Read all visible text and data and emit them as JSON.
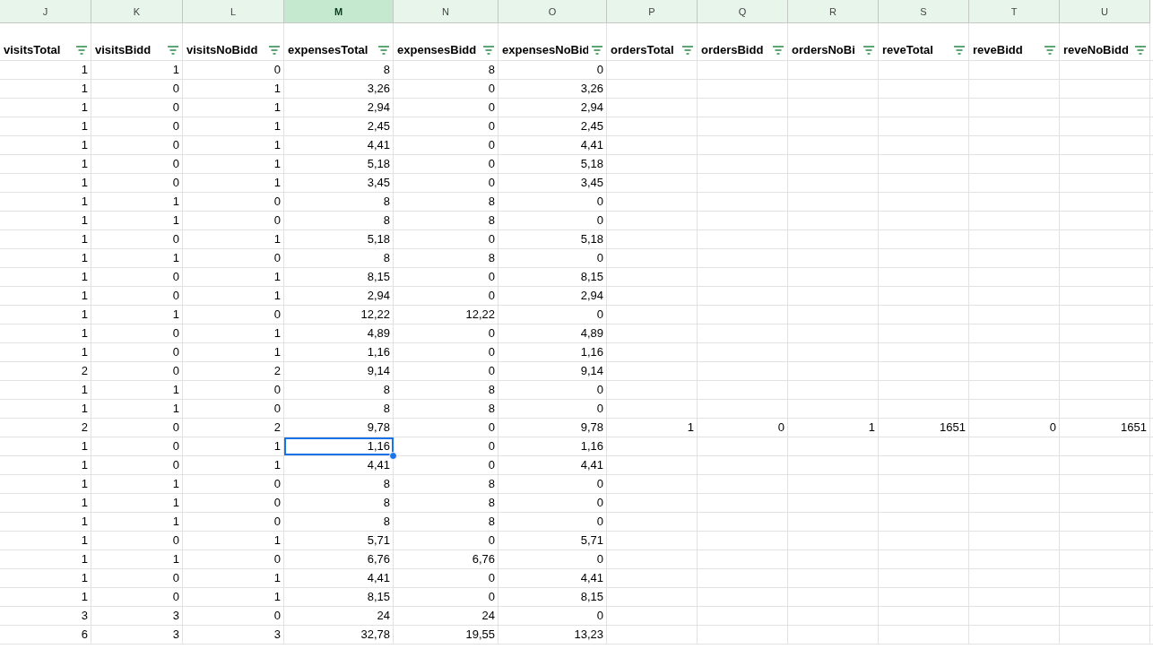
{
  "columns": [
    {
      "letter": "J",
      "header": "visitsTotal",
      "selected": false
    },
    {
      "letter": "K",
      "header": "visitsBidd",
      "selected": false
    },
    {
      "letter": "L",
      "header": "visitsNoBidd",
      "selected": false
    },
    {
      "letter": "M",
      "header": "expensesTotal",
      "selected": true
    },
    {
      "letter": "N",
      "header": "expensesBidd",
      "selected": false
    },
    {
      "letter": "O",
      "header": "expensesNoBid",
      "selected": false
    },
    {
      "letter": "P",
      "header": "ordersTotal",
      "selected": false
    },
    {
      "letter": "Q",
      "header": "ordersBidd",
      "selected": false
    },
    {
      "letter": "R",
      "header": "ordersNoBi",
      "selected": false
    },
    {
      "letter": "S",
      "header": "reveTotal",
      "selected": false
    },
    {
      "letter": "T",
      "header": "reveBidd",
      "selected": false
    },
    {
      "letter": "U",
      "header": "reveNoBidd",
      "selected": false
    }
  ],
  "rows": [
    {
      "selected": false,
      "cells": [
        "1",
        "1",
        "0",
        "8",
        "8",
        "0"
      ]
    },
    {
      "selected": false,
      "cells": [
        "1",
        "0",
        "1",
        "3,26",
        "0",
        "3,26"
      ]
    },
    {
      "selected": false,
      "cells": [
        "1",
        "0",
        "1",
        "2,94",
        "0",
        "2,94"
      ]
    },
    {
      "selected": false,
      "cells": [
        "1",
        "0",
        "1",
        "2,45",
        "0",
        "2,45"
      ]
    },
    {
      "selected": false,
      "cells": [
        "1",
        "0",
        "1",
        "4,41",
        "0",
        "4,41"
      ]
    },
    {
      "selected": false,
      "cells": [
        "1",
        "0",
        "1",
        "5,18",
        "0",
        "5,18"
      ]
    },
    {
      "selected": false,
      "cells": [
        "1",
        "0",
        "1",
        "3,45",
        "0",
        "3,45"
      ]
    },
    {
      "selected": false,
      "cells": [
        "1",
        "1",
        "0",
        "8",
        "8",
        "0"
      ]
    },
    {
      "selected": false,
      "cells": [
        "1",
        "1",
        "0",
        "8",
        "8",
        "0"
      ]
    },
    {
      "selected": false,
      "cells": [
        "1",
        "0",
        "1",
        "5,18",
        "0",
        "5,18"
      ]
    },
    {
      "selected": false,
      "cells": [
        "1",
        "1",
        "0",
        "8",
        "8",
        "0"
      ]
    },
    {
      "selected": false,
      "cells": [
        "1",
        "0",
        "1",
        "8,15",
        "0",
        "8,15"
      ]
    },
    {
      "selected": false,
      "cells": [
        "1",
        "0",
        "1",
        "2,94",
        "0",
        "2,94"
      ]
    },
    {
      "selected": false,
      "cells": [
        "1",
        "1",
        "0",
        "12,22",
        "12,22",
        "0"
      ]
    },
    {
      "selected": false,
      "cells": [
        "1",
        "0",
        "1",
        "4,89",
        "0",
        "4,89"
      ]
    },
    {
      "selected": false,
      "cells": [
        "1",
        "0",
        "1",
        "1,16",
        "0",
        "1,16"
      ]
    },
    {
      "selected": false,
      "cells": [
        "2",
        "0",
        "2",
        "9,14",
        "0",
        "9,14"
      ]
    },
    {
      "selected": false,
      "cells": [
        "1",
        "1",
        "0",
        "8",
        "8",
        "0"
      ]
    },
    {
      "selected": false,
      "cells": [
        "1",
        "1",
        "0",
        "8",
        "8",
        "0"
      ]
    },
    {
      "selected": false,
      "cells": [
        "2",
        "0",
        "2",
        "9,78",
        "0",
        "9,78",
        "1",
        "0",
        "1",
        "1651",
        "0",
        "1651"
      ]
    },
    {
      "selected": true,
      "cells": [
        "1",
        "0",
        "1",
        "1,16",
        "0",
        "1,16"
      ]
    },
    {
      "selected": false,
      "cells": [
        "1",
        "0",
        "1",
        "4,41",
        "0",
        "4,41"
      ]
    },
    {
      "selected": false,
      "cells": [
        "1",
        "1",
        "0",
        "8",
        "8",
        "0"
      ]
    },
    {
      "selected": false,
      "cells": [
        "1",
        "1",
        "0",
        "8",
        "8",
        "0"
      ]
    },
    {
      "selected": false,
      "cells": [
        "1",
        "1",
        "0",
        "8",
        "8",
        "0"
      ]
    },
    {
      "selected": false,
      "cells": [
        "1",
        "0",
        "1",
        "5,71",
        "0",
        "5,71"
      ]
    },
    {
      "selected": false,
      "cells": [
        "1",
        "1",
        "0",
        "6,76",
        "6,76",
        "0"
      ]
    },
    {
      "selected": false,
      "cells": [
        "1",
        "0",
        "1",
        "4,41",
        "0",
        "4,41"
      ]
    },
    {
      "selected": false,
      "cells": [
        "1",
        "0",
        "1",
        "8,15",
        "0",
        "8,15"
      ]
    },
    {
      "selected": false,
      "cells": [
        "3",
        "3",
        "0",
        "24",
        "24",
        "0"
      ]
    },
    {
      "selected": false,
      "cells": [
        "6",
        "3",
        "3",
        "32,78",
        "19,55",
        "13,23"
      ]
    }
  ]
}
